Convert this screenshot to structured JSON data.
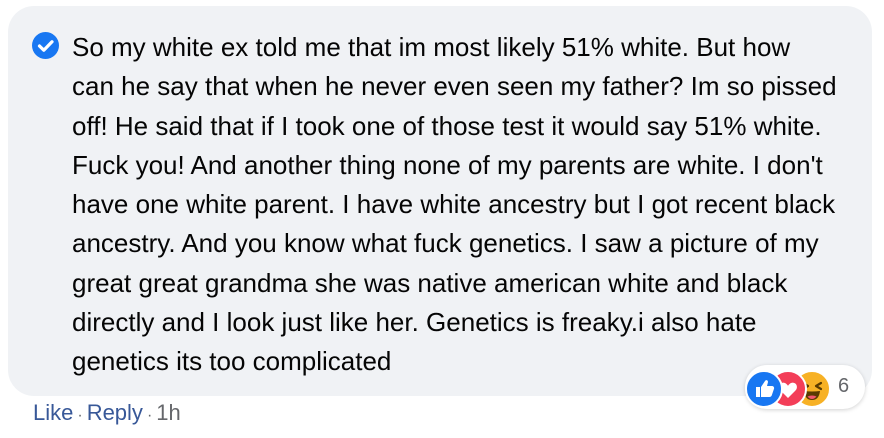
{
  "comment": {
    "lines": [
      "So my white ex told me that im most likely 51% white. But how",
      "can he say that when he never even seen my father? Im so pissed",
      "off! He said that if I took one of those test it would say 51% white.",
      "Fuck you! And another thing none of my parents are white. I don't",
      "have one white parent. I have white ancestry but I got recent black",
      "ancestry. And you know what fuck genetics. I saw a picture of my",
      "great great grandma she was native american white and black",
      "directly and I look just like her. Genetics is freaky.i also hate",
      "genetics its too complicated"
    ],
    "badge_icon": "check-circle-icon",
    "badge_color": "#1877f2"
  },
  "reactions": {
    "icons": [
      "like-icon",
      "love-icon",
      "haha-icon"
    ],
    "count": "6"
  },
  "actions": {
    "like": "Like",
    "reply": "Reply",
    "separator": "·",
    "time": "1h"
  },
  "colors": {
    "bubble": "#f0f2f5",
    "text": "#050505",
    "link": "#385898",
    "meta": "#65676b",
    "like": "#1877f2",
    "love": "#f33e58",
    "haha": "#f7b125"
  }
}
